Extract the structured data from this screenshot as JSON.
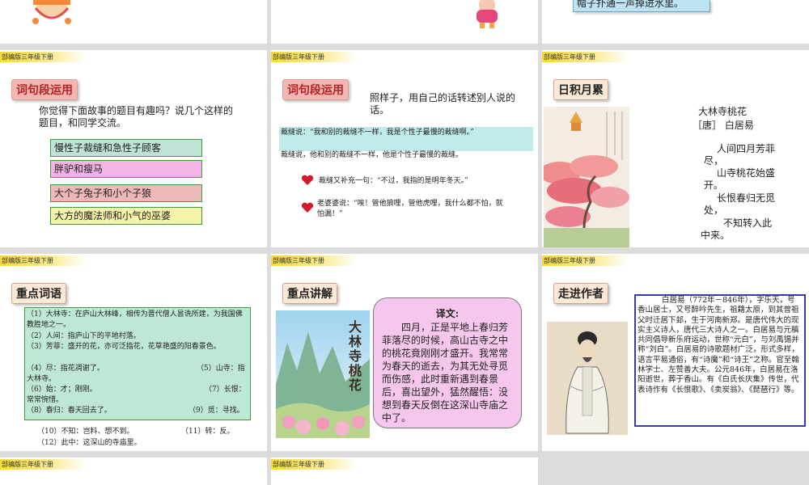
{
  "brand_label": "部编版三年级下册",
  "top_strip": {
    "text": "帽子扑通一声掉进水里。"
  },
  "s4": {
    "title": "词句段运用",
    "prompt": "你觉得下面故事的题目有趣吗？说几个这样的题目，和同学交流。",
    "options": [
      {
        "text": "慢性子裁缝和急性子顾客",
        "color": "#bfe3d8"
      },
      {
        "text": "胖驴和瘦马",
        "color": "#f4b3e6"
      },
      {
        "text": "大个子兔子和小个子狼",
        "color": "#efb8b8"
      },
      {
        "text": "大方的魔法师和小气的巫婆",
        "color": "#f5f3a9"
      }
    ]
  },
  "s5": {
    "title": "词句段运用",
    "prompt": "照样子，用自己的话转述别人说的话。",
    "quote": "裁缝说：“我和别的裁缝不一样，我是个性子最慢的裁缝啊。”",
    "retell": "裁缝说，他和别的裁缝不一样，他是个性子最慢的裁缝。",
    "bullets": [
      "裁缝又补充一句：“不过，我指的是明年冬天。”",
      "老婆婆说：“唉！管他狼哩，管他虎哩，我什么都不怕，就怕漏！”"
    ]
  },
  "s6": {
    "title": "日积月累",
    "poem_title": "大林寺桃花",
    "author": "［唐］ 白居易",
    "lines": [
      "人间四月芳菲尽，",
      "山寺桃花始盛开。",
      "长恨春归无觅处，",
      "不知转入此中来。"
    ]
  },
  "s7": {
    "title": "重点词语",
    "items": [
      "（1）大林寺：在庐山大林峰，相传为晋代僧人昙诜所建，为我国佛教胜地之一。",
      "（2）人间：指庐山下的平地村落。",
      "（3）芳菲：盛开的花，亦可泛指花，花草艳盛的阳春景色。",
      "（4）尽：指花凋谢了。",
      "（5）山寺：指大林寺。",
      "（6）始：才；刚刚。",
      "（7）长恨：常常惋惜。",
      "（8）春归：春天回去了。",
      "（9）觅：寻找。",
      "（10）不知：岂料、想不到。",
      "（11）转：反。",
      "（12）此中：这深山的寺庙里。"
    ]
  },
  "s8": {
    "title": "重点讲解",
    "image_text": "大林寺桃花",
    "trans_title": "译文:",
    "trans_body": "四月，正是平地上春归芳菲落尽的时候，高山古寺之中的桃花竟刚刚才盛开。我常常为春天的逝去，为其无处寻觅而伤感，此时重新遇到春景后，喜出望外，猛然醒悟：没想到春天反倒在这深山寺庙之中了。"
  },
  "s9": {
    "title": "走进作者",
    "bio": "白居易（772年－846年），字乐天，号香山居士，又号醉吟先生，祖籍太原，到其曾祖父时迁居下邽，生于河南新郑。是唐代伟大的现实主义诗人，唐代三大诗人之一。白居易与元稹共同倡导新乐府运动，世称“元白”，与刘禹锡并称“刘白”。白居易的诗歌题材广泛，形式多样，语言平易通俗，有“诗魔”和“诗王”之称。官至翰林学士、左赞善大夫。公元846年，白居易在洛阳逝世，葬于香山。有《白氏长庆集》传世，代表诗作有《长恨歌》、《卖炭翁》、《琵琶行》等。"
  }
}
